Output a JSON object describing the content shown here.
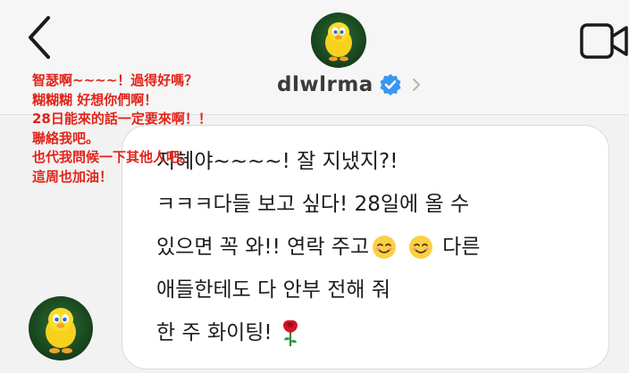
{
  "header": {
    "username": "dlwlrma",
    "back_icon": "chevron-left-icon",
    "video_icon": "video-camera-icon",
    "verified_icon": "verified-badge-icon"
  },
  "overlay": {
    "lines": [
      "智瑟啊~~~~！過得好嗎？",
      "糊糊糊 好想你們啊！",
      "28日能來的話一定要來啊！！",
      "聯絡我吧。",
      "也代我問候一下其他人吧。",
      "這周也加油！"
    ],
    "color": "#e2231a"
  },
  "message": {
    "line1": "지혜야~~~~! 잘 지냈지?!",
    "line2": "ㅋㅋㅋ다들 보고 싶다! 28일에 올 수",
    "line3a": "있으면 꼭 와!! 연락 주고",
    "line3b": "다른",
    "line4": "애들한테도 다 안부 전해 줘",
    "line5": "한 주 화이팅!",
    "emoji": [
      "smiling-face-icon",
      "smiling-face-icon",
      "rose-icon"
    ]
  }
}
